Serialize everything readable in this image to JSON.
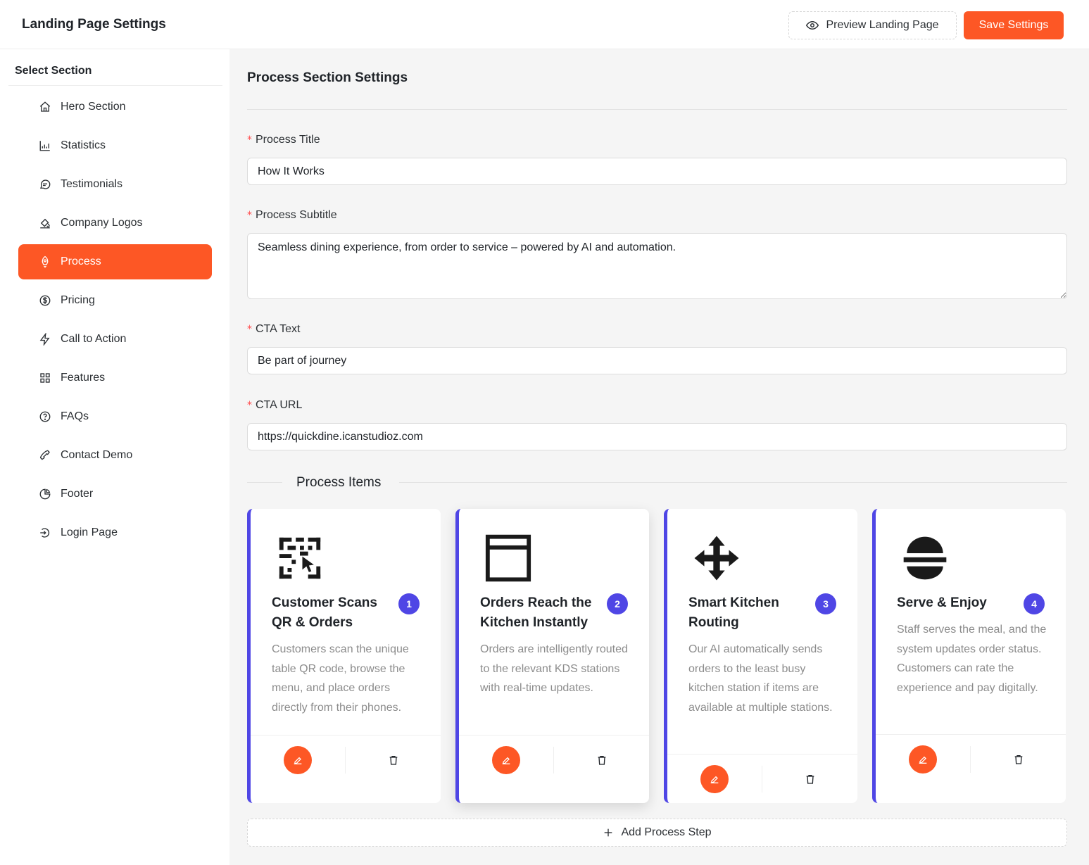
{
  "header": {
    "title": "Landing Page Settings",
    "preview_label": "Preview Landing Page",
    "save_label": "Save Settings"
  },
  "sidebar": {
    "title": "Select Section",
    "items": [
      {
        "label": "Hero Section",
        "icon": "home-icon"
      },
      {
        "label": "Statistics",
        "icon": "bar-chart-icon"
      },
      {
        "label": "Testimonials",
        "icon": "chat-icon"
      },
      {
        "label": "Company Logos",
        "icon": "paint-bucket-icon"
      },
      {
        "label": "Process",
        "icon": "rocket-icon",
        "active": true
      },
      {
        "label": "Pricing",
        "icon": "dollar-circle-icon"
      },
      {
        "label": "Call to Action",
        "icon": "lightning-icon"
      },
      {
        "label": "Features",
        "icon": "grid-icon"
      },
      {
        "label": "FAQs",
        "icon": "question-circle-icon"
      },
      {
        "label": "Contact Demo",
        "icon": "phone-icon"
      },
      {
        "label": "Footer",
        "icon": "pie-chart-icon"
      },
      {
        "label": "Login Page",
        "icon": "login-icon"
      }
    ]
  },
  "main": {
    "title": "Process Section Settings",
    "fields": {
      "process_title": {
        "label": "Process Title",
        "value": "How It Works"
      },
      "process_subtitle": {
        "label": "Process Subtitle",
        "value": "Seamless dining experience, from order to service – powered by AI and automation."
      },
      "cta_text": {
        "label": "CTA Text",
        "value": "Be part of journey"
      },
      "cta_url": {
        "label": "CTA URL",
        "value": "https://quickdine.icanstudioz.com"
      }
    },
    "items_title": "Process Items",
    "items": [
      {
        "number": "1",
        "title": "Customer Scans QR & Orders",
        "icon": "qr-scan-icon",
        "description": "Customers scan the unique table QR code, browse the menu, and place orders directly from their phones."
      },
      {
        "number": "2",
        "title": "Orders Reach the Kitchen Instantly",
        "icon": "window-icon",
        "description": "Orders are intelligently routed to the relevant KDS stations with real-time updates."
      },
      {
        "number": "3",
        "title": "Smart Kitchen Routing",
        "icon": "move-arrows-icon",
        "description": "Our AI automatically sends orders to the least busy kitchen station if items are available at multiple stations."
      },
      {
        "number": "4",
        "title": "Serve & Enjoy",
        "icon": "burger-icon",
        "description": "Staff serves the meal, and the system updates order status. Customers can rate the experience and pay digitally."
      }
    ],
    "add_step_label": "Add Process Step"
  },
  "colors": {
    "accent": "#fd5725",
    "badge": "#4f46e5",
    "main_bg": "#f5f5f5"
  }
}
